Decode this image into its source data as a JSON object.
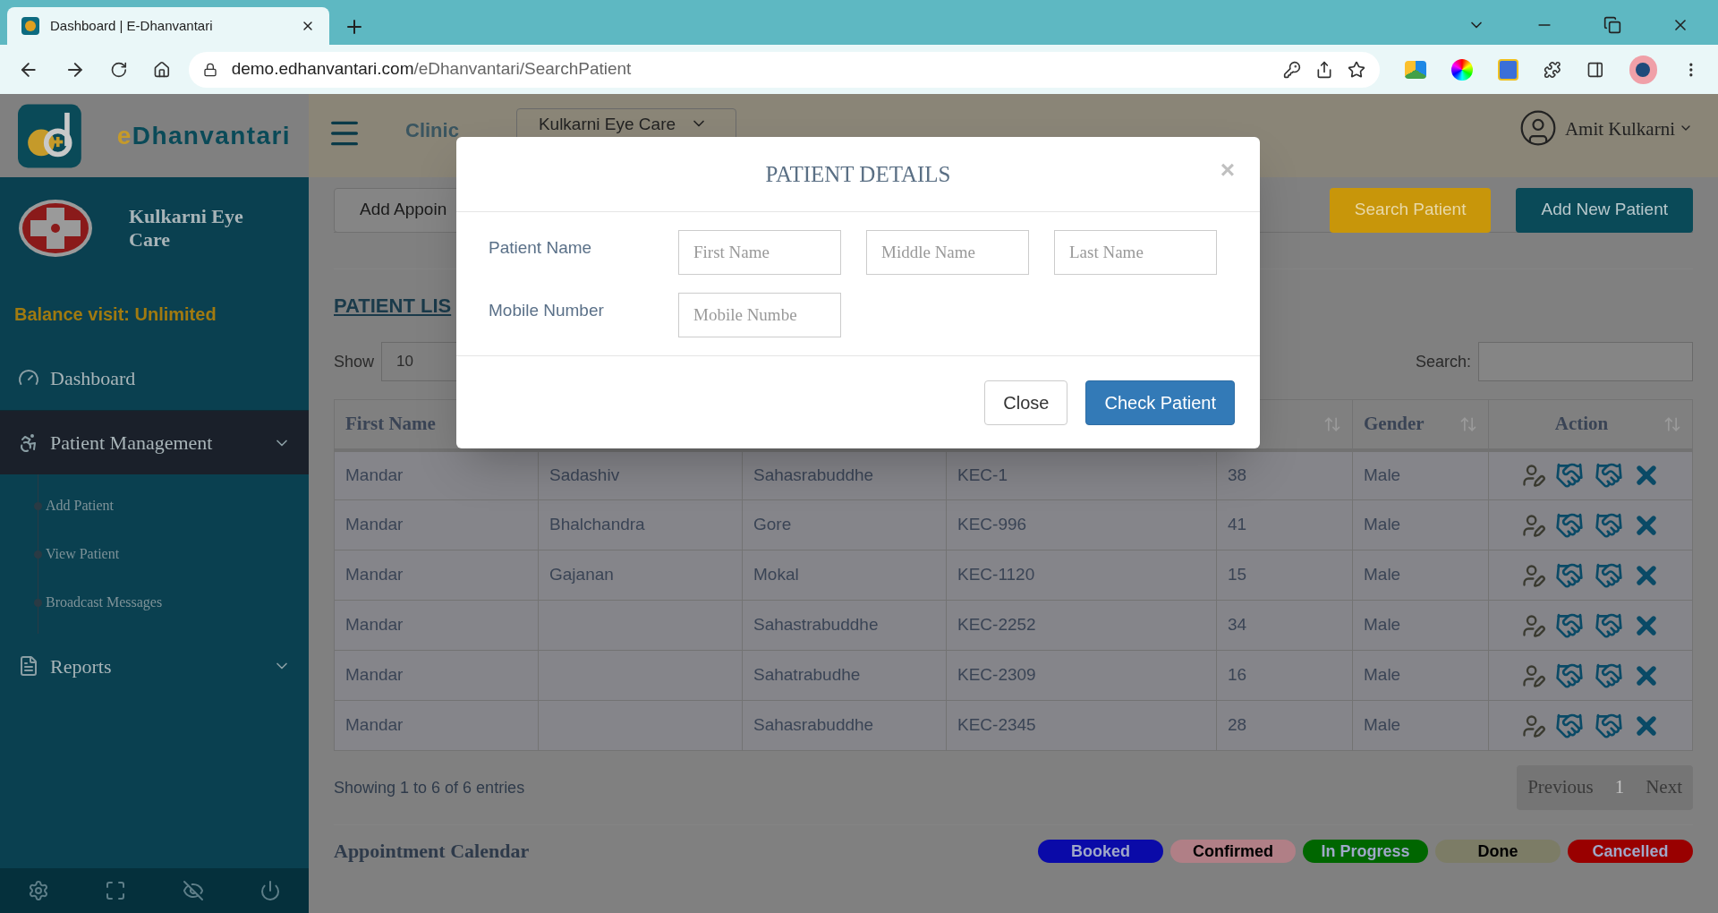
{
  "browser": {
    "tab_title": "Dashboard | E-Dhanvantari",
    "url_host": "demo.edhanvantari.com",
    "url_path": "/eDhanvantari/SearchPatient"
  },
  "header": {
    "clinic_label": "Clinic",
    "clinic_select": "Kulkarni Eye Care",
    "user": "Amit Kulkarni"
  },
  "sidebar": {
    "brand_prefix": "e",
    "brand_rest": "Dhanvantari",
    "clinic_name": "Kulkarni Eye Care",
    "balance": "Balance visit: Unlimited",
    "items": [
      {
        "label": "Dashboard",
        "kind": "dashboard",
        "expanded": false,
        "submenu": false
      },
      {
        "label": "Patient Management",
        "kind": "patients",
        "expanded": true,
        "submenu": true,
        "children": [
          {
            "label": "Add Patient"
          },
          {
            "label": "View Patient"
          },
          {
            "label": "Broadcast Messages"
          }
        ]
      },
      {
        "label": "Reports",
        "kind": "reports",
        "expanded": false,
        "submenu": true
      }
    ]
  },
  "toolbar": {
    "buttons": [
      {
        "label": "Add Appoin",
        "kind": "plain"
      },
      {
        "label": "Search Patient",
        "kind": "warning"
      },
      {
        "label": "Add New Patient",
        "kind": "primary"
      }
    ]
  },
  "list": {
    "heading": "PATIENT LIS",
    "show_label": "Show",
    "page_size": "10",
    "search_label": "Search:"
  },
  "table": {
    "first_column": "First Name",
    "right_columns": [
      {
        "sort_icon": true
      },
      {
        "label": "Gender",
        "sort_icon": true
      },
      {
        "label": "Action",
        "sort_icon": true
      }
    ],
    "rows": [
      {
        "first": "Mandar",
        "middle": "Sadashiv",
        "last": "Sahasrabuddhe",
        "id": "KEC-1",
        "age": "38",
        "gender": "Male"
      },
      {
        "first": "Mandar",
        "middle": "Bhalchandra",
        "last": "Gore",
        "id": "KEC-996",
        "age": "41",
        "gender": "Male"
      },
      {
        "first": "Mandar",
        "middle": "Gajanan",
        "last": "Mokal",
        "id": "KEC-1120",
        "age": "15",
        "gender": "Male"
      },
      {
        "first": "Mandar",
        "last": "Sahastrabuddhe",
        "id": "KEC-2252",
        "age": "34",
        "gender": "Male"
      },
      {
        "first": "Mandar",
        "last": "Sahatrabudhe",
        "id": "KEC-2309",
        "age": "16",
        "gender": "Male"
      },
      {
        "first": "Mandar",
        "last": "Sahasrabuddhe",
        "id": "KEC-2345",
        "age": "28",
        "gender": "Male"
      }
    ]
  },
  "footer": {
    "info": "Showing 1 to 6 of 6 entries",
    "pagination": [
      {
        "label": "Previous",
        "selected": false
      },
      {
        "label": "1",
        "selected": true
      },
      {
        "label": "Next",
        "selected": false
      }
    ]
  },
  "calendar": {
    "title": "Appointment Calendar",
    "legend": [
      {
        "label": "Booked",
        "color": "#0a0aa8"
      },
      {
        "label": "Confirmed",
        "color": "#b07f86"
      },
      {
        "label": "In Progress",
        "color": "#006600"
      },
      {
        "label": "Done",
        "color": "#7c7c66"
      },
      {
        "label": "Cancelled",
        "color": "#990000"
      }
    ]
  },
  "modal": {
    "title": "PATIENT DETAILS",
    "close": "×",
    "name_label": "Patient Name",
    "name_placeholders": [
      "First Name",
      "Middle Name",
      "Last Name"
    ],
    "mobile_label": "Mobile Number",
    "mobile_placeholder": "Mobile Numbe",
    "buttons": [
      {
        "label": "Close",
        "kind": "default"
      },
      {
        "label": "Check Patient",
        "kind": "primary"
      }
    ]
  }
}
